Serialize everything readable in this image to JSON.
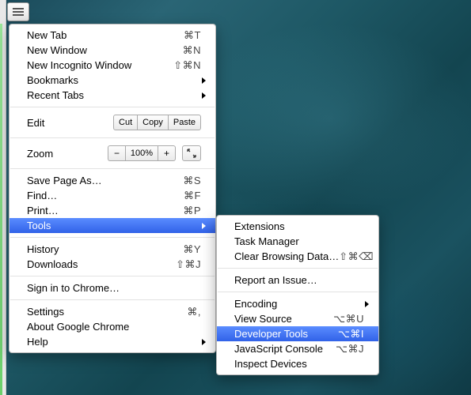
{
  "menu": {
    "new_tab": {
      "label": "New Tab",
      "shortcut": "⌘T"
    },
    "new_window": {
      "label": "New Window",
      "shortcut": "⌘N"
    },
    "new_incognito": {
      "label": "New Incognito Window",
      "shortcut": "⇧⌘N"
    },
    "bookmarks": {
      "label": "Bookmarks"
    },
    "recent_tabs": {
      "label": "Recent Tabs"
    },
    "edit": {
      "label": "Edit",
      "cut": "Cut",
      "copy": "Copy",
      "paste": "Paste"
    },
    "zoom": {
      "label": "Zoom",
      "level": "100%"
    },
    "save_as": {
      "label": "Save Page As…",
      "shortcut": "⌘S"
    },
    "find": {
      "label": "Find…",
      "shortcut": "⌘F"
    },
    "print": {
      "label": "Print…",
      "shortcut": "⌘P"
    },
    "tools": {
      "label": "Tools"
    },
    "history": {
      "label": "History",
      "shortcut": "⌘Y"
    },
    "downloads": {
      "label": "Downloads",
      "shortcut": "⇧⌘J"
    },
    "signin": {
      "label": "Sign in to Chrome…"
    },
    "settings": {
      "label": "Settings",
      "shortcut": "⌘,"
    },
    "about": {
      "label": "About Google Chrome"
    },
    "help": {
      "label": "Help"
    }
  },
  "submenu": {
    "extensions": {
      "label": "Extensions"
    },
    "task_manager": {
      "label": "Task Manager"
    },
    "clear_browsing": {
      "label": "Clear Browsing Data…",
      "shortcut": "⇧⌘⌫"
    },
    "report_issue": {
      "label": "Report an Issue…"
    },
    "encoding": {
      "label": "Encoding"
    },
    "view_source": {
      "label": "View Source",
      "shortcut": "⌥⌘U"
    },
    "developer_tools": {
      "label": "Developer Tools",
      "shortcut": "⌥⌘I"
    },
    "js_console": {
      "label": "JavaScript Console",
      "shortcut": "⌥⌘J"
    },
    "inspect_devices": {
      "label": "Inspect Devices"
    }
  }
}
